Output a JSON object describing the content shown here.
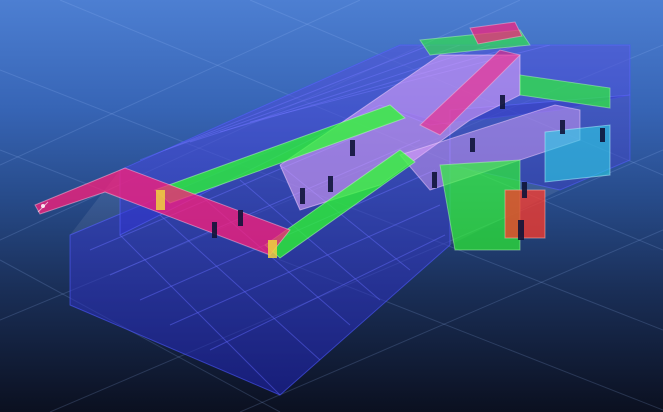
{
  "viewer": {
    "background": {
      "top": "#4d7fd2",
      "mid": "#274b8a",
      "bottom": "#0b1020",
      "grid_line": "#9fc2ff"
    },
    "palette": {
      "room_blue": "#1a1fb8",
      "room_blue_edge": "#4a55ff",
      "corridor_magenta": "#ff1e7a",
      "corridor_green": "#2cff2c",
      "corridor_lilac": "#e7a6ff",
      "cyan": "#2bd2e6",
      "red": "#ff3a2a",
      "yellow": "#f0d040",
      "door_dark": "#10143a"
    }
  }
}
